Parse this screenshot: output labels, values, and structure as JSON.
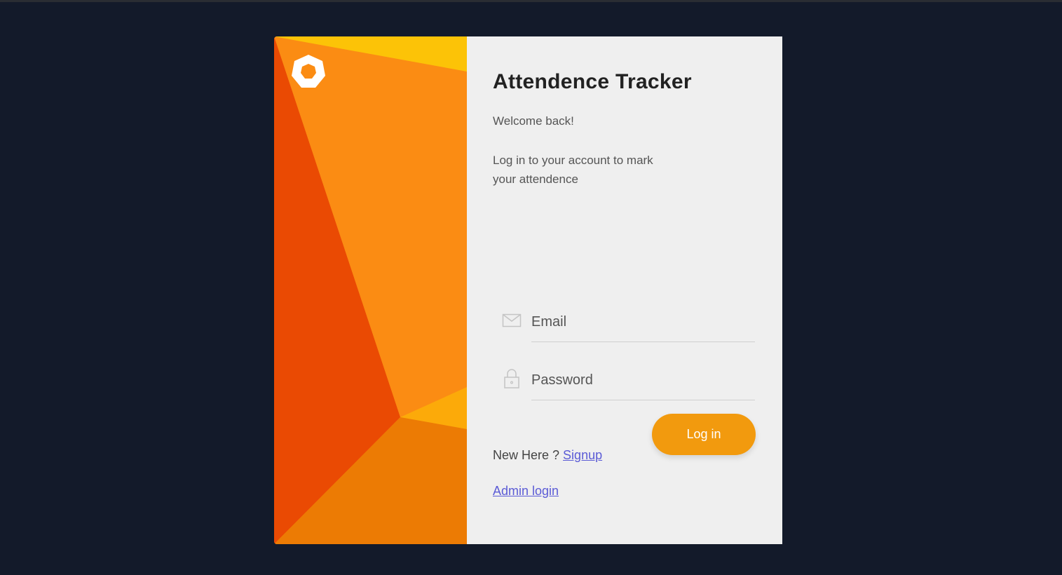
{
  "app": {
    "title": "Attendence Tracker",
    "welcome": "Welcome back!",
    "description": "Log in to your account to mark your attendence"
  },
  "form": {
    "email": {
      "placeholder": "Email",
      "value": "",
      "icon": "envelope-icon"
    },
    "password": {
      "placeholder": "Password",
      "value": "",
      "icon": "lock-icon"
    },
    "login_label": "Log in"
  },
  "links": {
    "new_here": "New Here ? ",
    "signup": "Signup",
    "admin_login": "Admin login"
  },
  "colors": {
    "background": "#131a2a",
    "panel": "#efefef",
    "accent": "#f29a0e",
    "link": "#5b5bd6",
    "art_yellow": "#fcc307",
    "art_orange": "#fb8c13",
    "art_red": "#ea4a03",
    "art_dark_orange": "#ec7b04"
  }
}
